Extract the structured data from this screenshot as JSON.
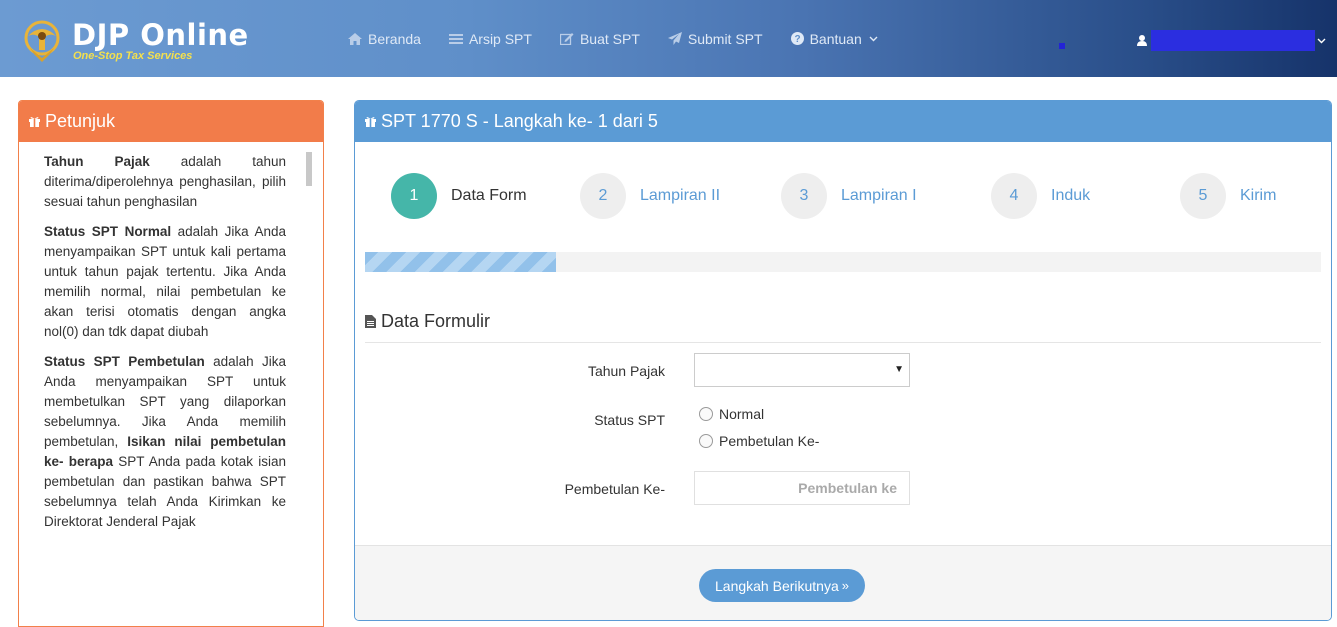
{
  "brand": {
    "title": "DJP Online",
    "subtitle": "One-Stop Tax Services"
  },
  "nav": {
    "items": [
      {
        "label": "Beranda",
        "icon": "home-icon"
      },
      {
        "label": "Arsip SPT",
        "icon": "list-icon"
      },
      {
        "label": "Buat SPT",
        "icon": "edit-icon"
      },
      {
        "label": "Submit SPT",
        "icon": "send-icon"
      },
      {
        "label": "Bantuan",
        "icon": "question-icon"
      }
    ]
  },
  "user": {
    "icon": "user-icon"
  },
  "petunjuk": {
    "title": "Petunjuk",
    "p1_bold": "Tahun Pajak",
    "p1_text": " adalah tahun diterima/diperolehnya penghasilan, pilih sesuai tahun penghasilan",
    "p2_bold": "Status SPT Normal",
    "p2_text": " adalah Jika Anda menyampaikan SPT untuk kali pertama untuk tahun pajak tertentu. Jika Anda memilih normal, nilai pembetulan ke akan terisi otomatis dengan angka nol(0) dan tdk dapat diubah",
    "p3_bold": "Status SPT Pembetulan",
    "p3_text1": " adalah Jika Anda menyampaikan SPT untuk membetulkan SPT yang dilaporkan sebelumnya. Jika Anda memilih pembetulan, ",
    "p3_bold2": "Isikan nilai pembetulan ke- berapa",
    "p3_text2": " SPT Anda pada kotak isian pembetulan dan pastikan bahwa SPT sebelumnya telah Anda Kirimkan ke Direktorat Jenderal Pajak"
  },
  "main": {
    "title": "SPT 1770 S - Langkah ke- 1 dari 5",
    "steps": [
      {
        "num": "1",
        "label": "Data Form"
      },
      {
        "num": "2",
        "label": "Lampiran II"
      },
      {
        "num": "3",
        "label": "Lampiran I"
      },
      {
        "num": "4",
        "label": "Induk"
      },
      {
        "num": "5",
        "label": "Kirim"
      }
    ],
    "progress": 0.2,
    "section_title": "Data Formulir",
    "form": {
      "tahun_label": "Tahun Pajak",
      "tahun_value": "",
      "status_label": "Status SPT",
      "status_options": [
        "Normal",
        "Pembetulan Ke-"
      ],
      "pembetulan_label": "Pembetulan Ke-",
      "pembetulan_placeholder": "Pembetulan ke"
    },
    "next_button": "Langkah Berikutnya"
  }
}
